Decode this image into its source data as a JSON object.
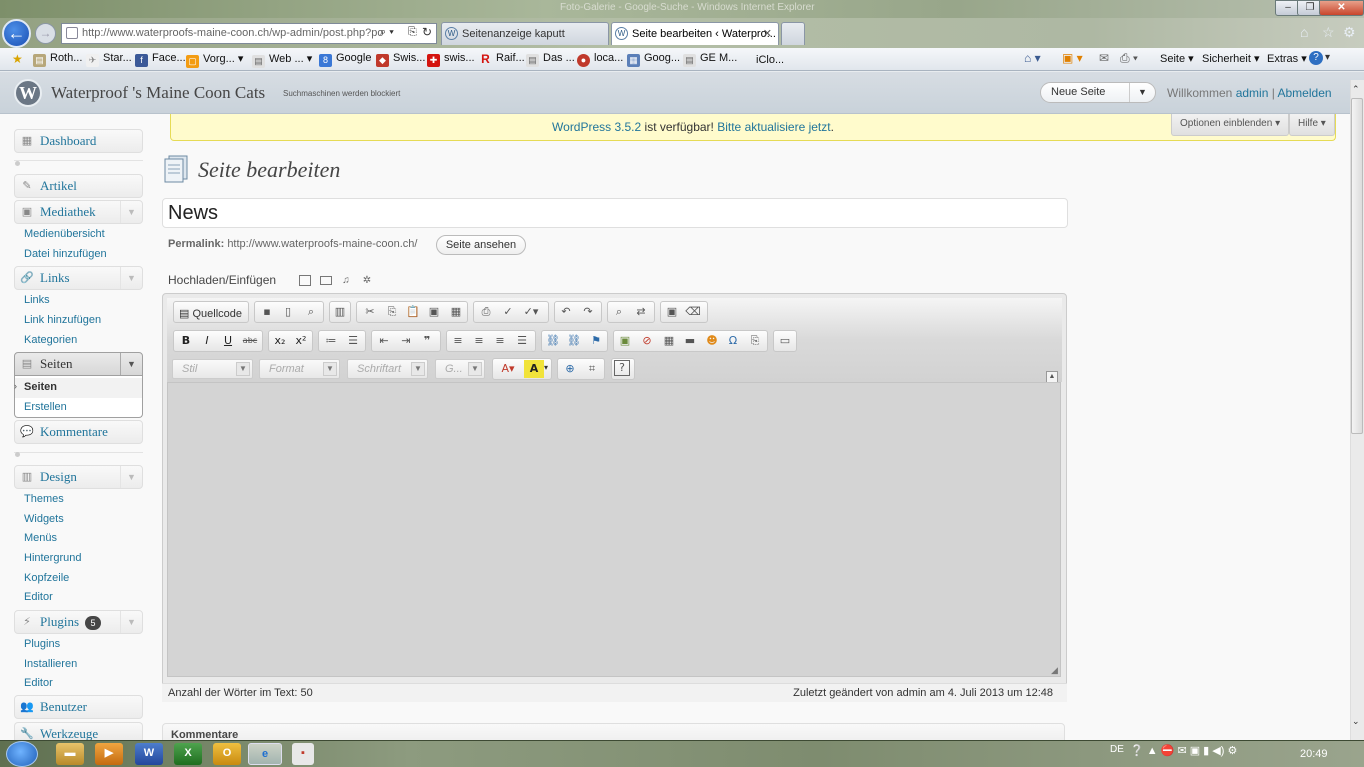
{
  "browser": {
    "window_title": "Foto-Galerie - Google-Suche - Windows Internet Explorer",
    "address": "http://www.waterproofs-maine-coon.ch/wp-admin/post.php?po",
    "address_host": "waterproofs-maine-coon.ch",
    "tabs": [
      {
        "label": "Seitenanzeige kaputt",
        "active": false
      },
      {
        "label": "Seite bearbeiten ‹ Waterpro...",
        "active": true
      }
    ],
    "favorites": [
      "Roth...",
      "Star...",
      "Face...",
      "Vorg...",
      "Web ...",
      "Google",
      "Swis...",
      "swis...",
      "Raif...",
      "Das ...",
      "loca...",
      "Goog...",
      "GE M...",
      "iClo..."
    ],
    "commands": [
      "Seite",
      "Sicherheit",
      "Extras"
    ]
  },
  "header": {
    "site_name": "Waterproof 's Maine Coon Cats",
    "blocked_note": "Suchmaschinen werden blockiert",
    "new_page": "Neue Seite",
    "welcome": "Willkommen",
    "user": "admin",
    "logout": "Abmelden"
  },
  "sidebar": {
    "dashboard": "Dashboard",
    "posts": "Artikel",
    "media": "Mediathek",
    "media_items": [
      "Medienübersicht",
      "Datei hinzufügen"
    ],
    "links": "Links",
    "links_items": [
      "Links",
      "Link hinzufügen",
      "Kategorien"
    ],
    "pages": "Seiten",
    "pages_items": [
      "Seiten",
      "Erstellen"
    ],
    "comments": "Kommentare",
    "design": "Design",
    "design_items": [
      "Themes",
      "Widgets",
      "Menüs",
      "Hintergrund",
      "Kopfzeile",
      "Editor"
    ],
    "plugins": "Plugins",
    "plugins_badge": "5",
    "plugins_items": [
      "Plugins",
      "Installieren",
      "Editor"
    ],
    "users": "Benutzer",
    "tools": "Werkzeuge"
  },
  "notice": {
    "version_link": "WordPress 3.5.2",
    "text": " ist verfügbar! ",
    "update_link": "Bitte aktualisiere jetzt",
    "end": "."
  },
  "screen": {
    "options": "Optionen einblenden ▾",
    "help": "Hilfe ▾"
  },
  "main": {
    "title": "Seite bearbeiten",
    "post_title": "News",
    "permalink_label": "Permalink:",
    "permalink_url": "http://www.waterproofs-maine-coon.ch/",
    "view_button": "Seite ansehen",
    "upload_label": "Hochladen/Einfügen"
  },
  "editor": {
    "source_button": "Quellcode",
    "style_select": "Stil",
    "format_select": "Format",
    "font_select": "Schriftart",
    "size_select": "G...",
    "word_count_label": "Anzahl der Wörter im Text: 50",
    "last_edited": "Zuletzt geändert von admin am 4. Juli 2013 um 12:48"
  },
  "comments_box": {
    "title": "Kommentare"
  },
  "taskbar": {
    "language": "DE",
    "clock": "20:49"
  }
}
